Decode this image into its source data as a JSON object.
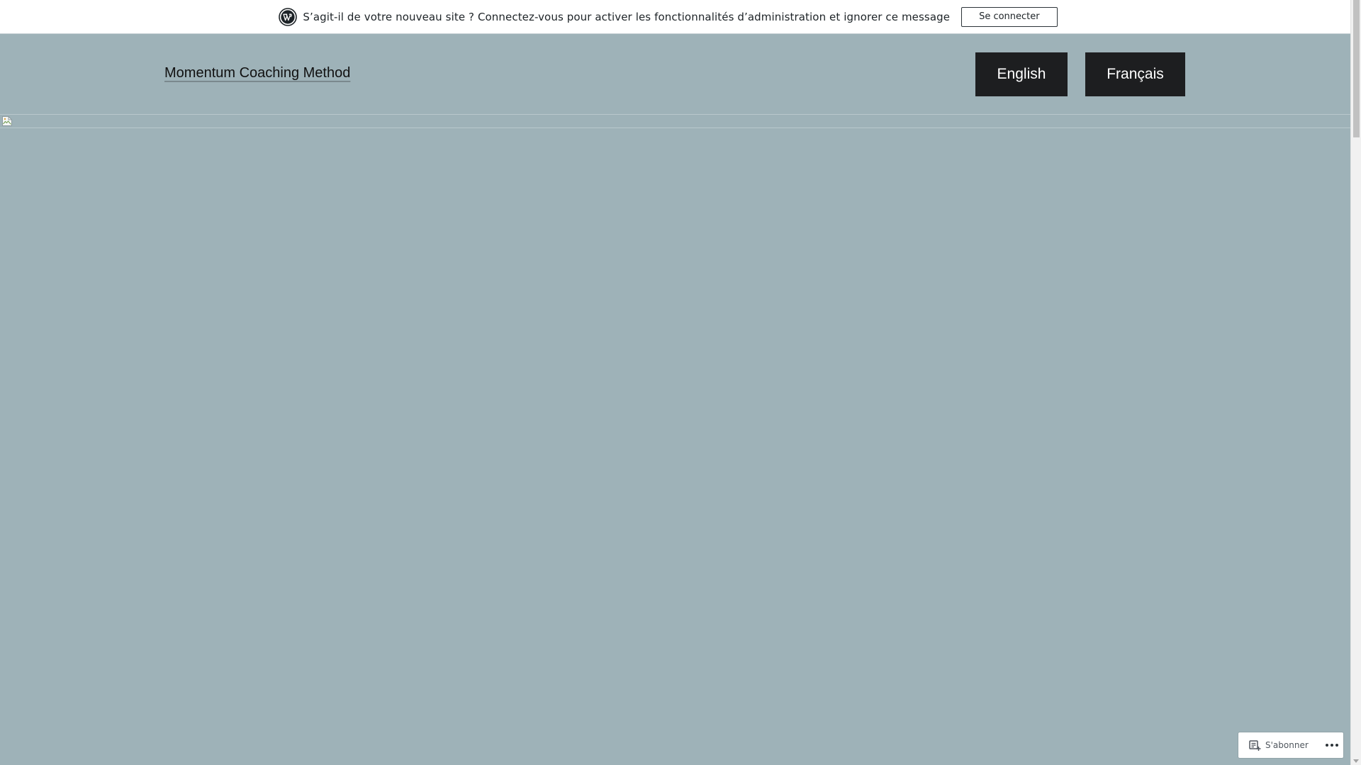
{
  "notice": {
    "message": "S’agit-il de votre nouveau site ? Connectez-vous pour activer les fonctionnalités d’administration et ignorer ce message",
    "login_label": "Se connecter",
    "logo_icon": "wordpress-logo-icon"
  },
  "header": {
    "site_title": "Momentum Coaching Method",
    "languages": [
      {
        "label": "English"
      },
      {
        "label": "Français"
      }
    ]
  },
  "hero": {
    "image_icon": "broken-image-icon"
  },
  "subscribe": {
    "label": "S'abonner",
    "icon": "reader-subscribe-icon",
    "more_icon": "more-horizontal-icon"
  },
  "colors": {
    "page_background": "#9eb2b8",
    "notice_background": "#ffffff",
    "language_button_background": "#1d1e20",
    "language_button_text": "#ffffff"
  }
}
